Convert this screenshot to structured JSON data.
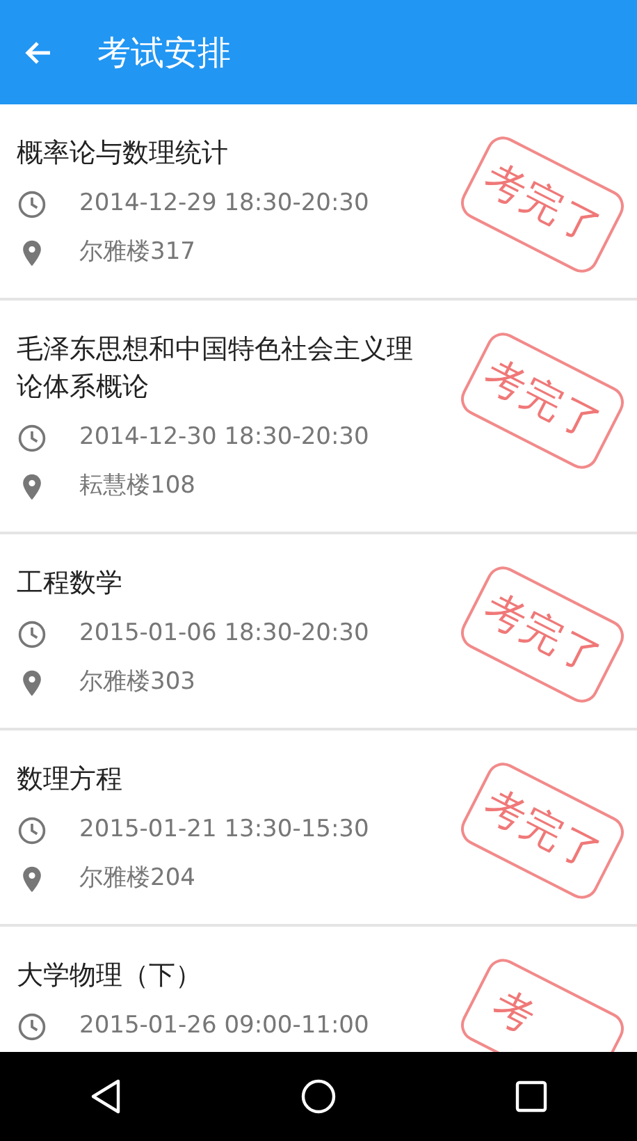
{
  "app_bar": {
    "title": "考试安排"
  },
  "exams": [
    {
      "title": "概率论与数理统计",
      "time": "2014-12-29 18:30-20:30",
      "location": "尔雅楼317",
      "stamp": "考完了"
    },
    {
      "title": "毛泽东思想和中国特色社会主义理论体系概论",
      "time": "2014-12-30 18:30-20:30",
      "location": "耘慧楼108",
      "stamp": "考完了"
    },
    {
      "title": "工程数学",
      "time": "2015-01-06 18:30-20:30",
      "location": "尔雅楼303",
      "stamp": "考完了"
    },
    {
      "title": "数理方程",
      "time": "2015-01-21 13:30-15:30",
      "location": "尔雅楼204",
      "stamp": "考完了"
    },
    {
      "title": "大学物理（下）",
      "time": "2015-01-26 09:00-11:00",
      "stamp": "考"
    }
  ]
}
